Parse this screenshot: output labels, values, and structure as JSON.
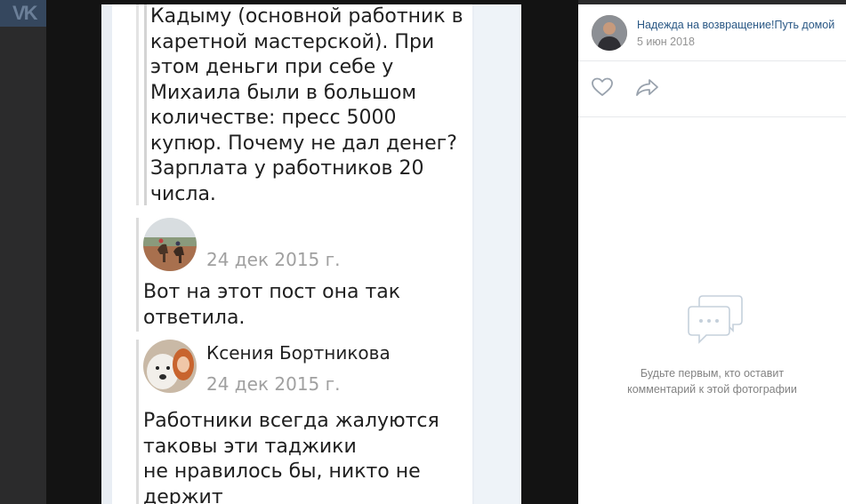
{
  "photo": {
    "quote_text": "Кадыму (основной работник в\nкаретной мастерской). При\nэтом деньги при себе у\nМихаила были в большом\nколичестве: пресс 5000\nкупюр. Почему не дал денег?\nЗарплата у работников 20\nчисла.",
    "replies": [
      {
        "name": "",
        "date": "24 дек 2015 г.",
        "text": "Вот на этот пост она так\nответила."
      },
      {
        "name": "Ксения Бортникова",
        "date": "24 дек 2015 г.",
        "text": "Работники всегда жалуются\nтаковы эти таджики\nне нравилось бы, никто не\nдержит"
      }
    ]
  },
  "sidebar": {
    "author_name": "Надежда на возвращение!Путь домой",
    "post_date": "5 июн 2018",
    "like_icon": "heart-icon",
    "share_icon": "share-icon",
    "empty_icon": "comments-icon",
    "empty_text": "Будьте первым, кто оставит\nкомментарий к этой фотографии"
  },
  "colors": {
    "header_bg": "#35475e",
    "link": "#2a5885",
    "muted": "#939393",
    "icon": "#99a2ad"
  }
}
